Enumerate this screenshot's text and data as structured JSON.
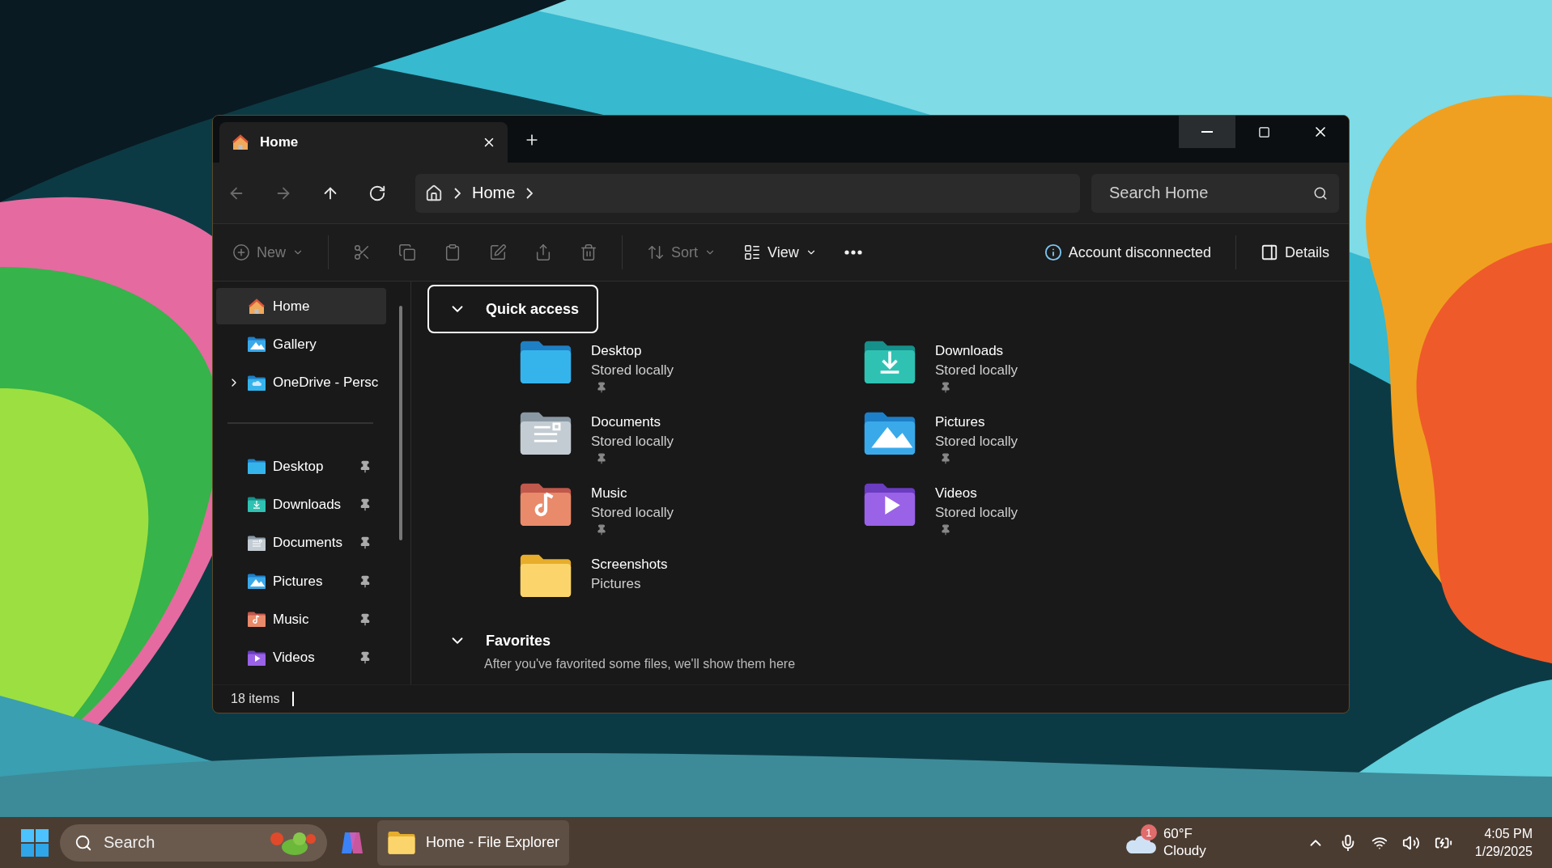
{
  "window": {
    "tabs": [
      {
        "label": "Home",
        "selected": true
      }
    ],
    "nav": [
      {
        "kind": "back",
        "disabled": true
      },
      {
        "kind": "forward",
        "disabled": true
      },
      {
        "kind": "up",
        "disabled": false
      },
      {
        "kind": "refresh",
        "disabled": false
      }
    ],
    "address": {
      "crumbs": [
        "Home"
      ]
    },
    "search": {
      "placeholder": "Search Home"
    },
    "toolbar": [
      {
        "kind": "new",
        "label": "New",
        "disabled": true
      },
      {
        "kind": "cut",
        "disabled": true
      },
      {
        "kind": "copy",
        "disabled": true
      },
      {
        "kind": "paste",
        "disabled": true
      },
      {
        "kind": "rename",
        "disabled": true
      },
      {
        "kind": "share",
        "disabled": true
      },
      {
        "kind": "delete",
        "disabled": true
      },
      {
        "kind": "sort",
        "label": "Sort",
        "disabled": true
      },
      {
        "kind": "view",
        "label": "View",
        "disabled": false
      },
      {
        "kind": "more",
        "disabled": false
      }
    ],
    "account": "Account disconnected",
    "details": "Details",
    "sidebar": {
      "top": [
        {
          "kind": "home",
          "label": "Home",
          "selected": true,
          "expandable": false
        },
        {
          "kind": "gallery",
          "label": "Gallery",
          "selected": false,
          "expandable": false
        },
        {
          "kind": "onedrive",
          "label": "OneDrive - Persc",
          "selected": false,
          "expandable": true
        }
      ],
      "pinned": [
        {
          "kind": "desktop",
          "label": "Desktop",
          "selected": false,
          "pinned": true
        },
        {
          "kind": "downloads",
          "label": "Downloads",
          "selected": false,
          "pinned": true
        },
        {
          "kind": "documents",
          "label": "Documents",
          "selected": false,
          "pinned": true
        },
        {
          "kind": "pictures",
          "label": "Pictures",
          "selected": false,
          "pinned": true
        },
        {
          "kind": "music",
          "label": "Music",
          "selected": false,
          "pinned": true
        },
        {
          "kind": "videos",
          "label": "Videos",
          "selected": false,
          "pinned": true
        }
      ]
    },
    "quick_access": {
      "title": "Quick access",
      "expanded": true,
      "items": [
        {
          "kind": "desktop",
          "name": "Desktop",
          "detail": "Stored locally",
          "pinned": true
        },
        {
          "kind": "downloads",
          "name": "Downloads",
          "detail": "Stored locally",
          "pinned": true
        },
        {
          "kind": "documents",
          "name": "Documents",
          "detail": "Stored locally",
          "pinned": true
        },
        {
          "kind": "pictures",
          "name": "Pictures",
          "detail": "Stored locally",
          "pinned": true
        },
        {
          "kind": "music",
          "name": "Music",
          "detail": "Stored locally",
          "pinned": true
        },
        {
          "kind": "videos",
          "name": "Videos",
          "detail": "Stored locally",
          "pinned": true
        },
        {
          "kind": "screenshots",
          "name": "Screenshots",
          "detail": "Pictures",
          "pinned": false
        }
      ]
    },
    "favorites": {
      "title": "Favorites",
      "expanded": true,
      "message": "After you've favorited some files, we'll show them here"
    },
    "status_bar": {
      "count": "18 items"
    }
  },
  "taskbar": {
    "search": {
      "placeholder": "Search"
    },
    "apps": [
      {
        "label": "Home - File Explorer",
        "active": true
      }
    ],
    "weather": {
      "badge": "1",
      "temperature": "60°F",
      "condition": "Cloudy"
    },
    "clock": {
      "time": "4:05 PM",
      "date": "1/29/2025"
    }
  }
}
